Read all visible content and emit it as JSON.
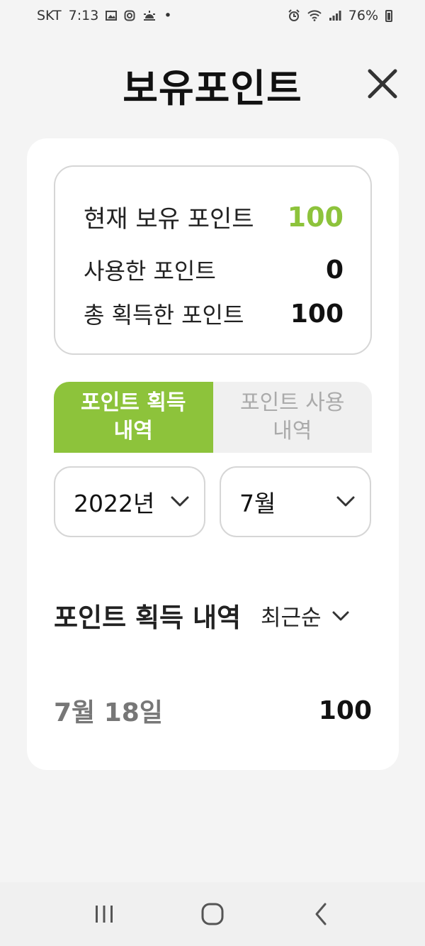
{
  "status_bar": {
    "carrier": "SKT",
    "time": "7:13",
    "dot": "•",
    "battery": "76%",
    "icons": [
      "gallery-icon",
      "instagram-icon",
      "weather-icon",
      "alarm-icon",
      "wifi-icon",
      "signal-icon",
      "battery-icon"
    ]
  },
  "header": {
    "title": "보유포인트",
    "close_icon": "close-icon"
  },
  "summary": {
    "current_label": "현재 보유 포인트",
    "current_value": "100",
    "used_label": "사용한 포인트",
    "used_value": "0",
    "total_label": "총 획득한 포인트",
    "total_value": "100"
  },
  "tabs": [
    {
      "label_line1": "포인트 획득",
      "label_line2": "내역",
      "active": true
    },
    {
      "label_line1": "포인트 사용",
      "label_line2": "내역",
      "active": false
    }
  ],
  "filters": {
    "year": "2022년",
    "month": "7월"
  },
  "section": {
    "title": "포인트 획득 내역",
    "sort_label": "최근순"
  },
  "history": [
    {
      "date": "7월 18일",
      "amount": "100"
    }
  ],
  "colors": {
    "accent": "#8dc33b",
    "background": "#f4f4f4",
    "card": "#ffffff",
    "tab_inactive": "#f0f0f0"
  },
  "nav": {
    "recent_icon": "recent-apps-icon",
    "home_icon": "home-icon",
    "back_icon": "back-icon"
  }
}
